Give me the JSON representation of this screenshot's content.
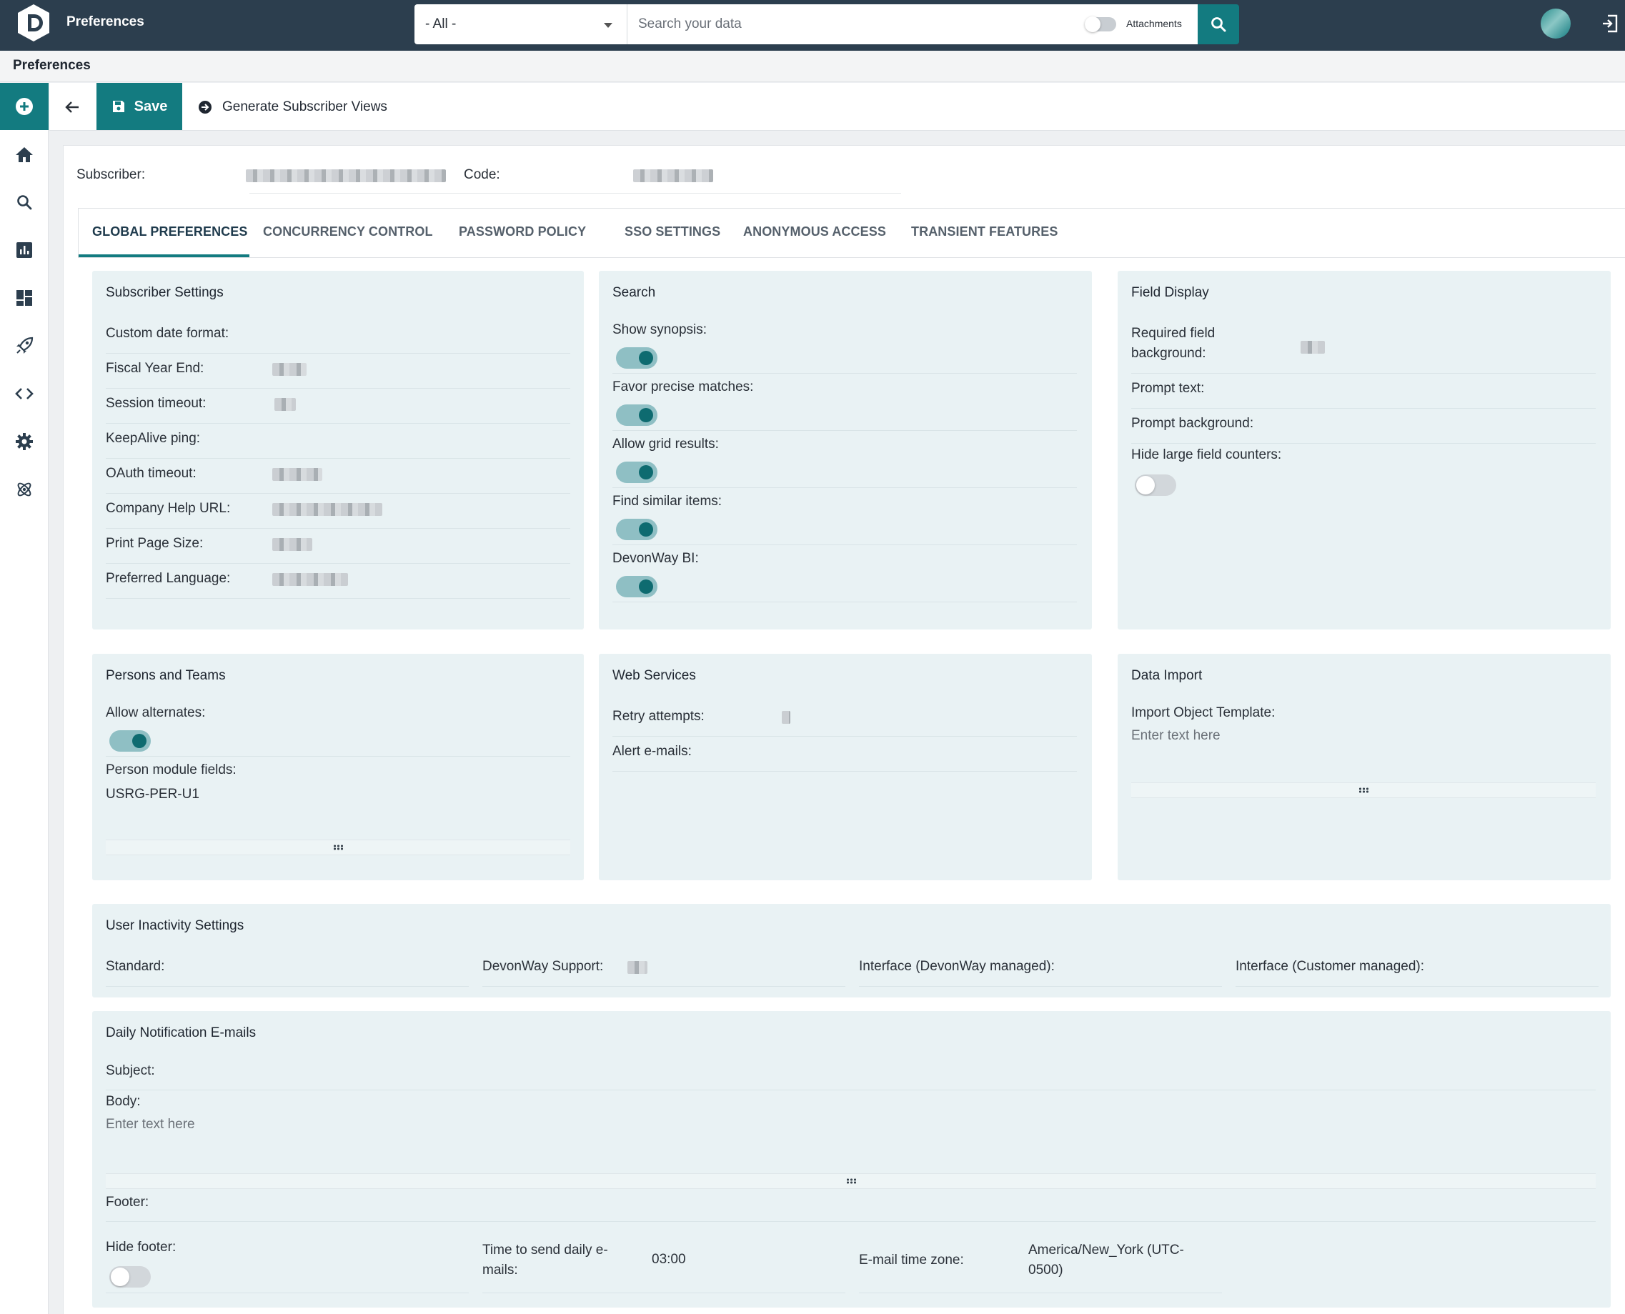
{
  "topbar": {
    "app_title": "Preferences",
    "scope_select": "- All -",
    "search_placeholder": "Search your data",
    "attachments_label": "Attachments"
  },
  "breadcrumb": "Preferences",
  "toolbar": {
    "save_label": "Save",
    "generate_label": "Generate Subscriber Views"
  },
  "header": {
    "subscriber_label": "Subscriber:",
    "code_label": "Code:"
  },
  "tabs": [
    "GLOBAL PREFERENCES",
    "CONCURRENCY CONTROL",
    "PASSWORD POLICY",
    "SSO SETTINGS",
    "ANONYMOUS ACCESS",
    "TRANSIENT FEATURES"
  ],
  "subscriber_settings": {
    "title": "Subscriber Settings",
    "rows": [
      "Custom date format:",
      "Fiscal Year End:",
      "Session timeout:",
      "KeepAlive ping:",
      "OAuth timeout:",
      "Company Help URL:",
      "Print Page Size:",
      "Preferred Language:"
    ]
  },
  "search_panel": {
    "title": "Search",
    "rows": [
      "Show synopsis:",
      "Favor precise matches:",
      "Allow grid results:",
      "Find similar items:",
      "DevonWay BI:"
    ]
  },
  "field_display": {
    "title": "Field Display",
    "required_bg": "Required field background:",
    "prompt_text": "Prompt text:",
    "prompt_bg": "Prompt background:",
    "hide_counters": "Hide large field counters:"
  },
  "persons_teams": {
    "title": "Persons and Teams",
    "allow_alternates": "Allow alternates:",
    "module_fields": "Person module fields:",
    "module_value": "USRG-PER-U1"
  },
  "web_services": {
    "title": "Web Services",
    "retry": "Retry attempts:",
    "alert": "Alert e-mails:"
  },
  "data_import": {
    "title": "Data Import",
    "template": "Import Object Template:",
    "placeholder": "Enter text here"
  },
  "inactivity": {
    "title": "User Inactivity Settings",
    "standard": "Standard:",
    "support": "DevonWay Support:",
    "iface_dw": "Interface (DevonWay managed):",
    "iface_cust": "Interface (Customer managed):"
  },
  "daily": {
    "title": "Daily Notification E-mails",
    "subject": "Subject:",
    "body": "Body:",
    "body_placeholder": "Enter text here",
    "footer": "Footer:",
    "hide_footer": "Hide footer:",
    "time_label": "Time to send daily e-mails:",
    "time_value": "03:00",
    "tz_label": "E-mail time zone:",
    "tz_value": "America/New_York (UTC-0500)"
  },
  "colors": {
    "topbar": "#2c3e4e",
    "accent": "#137b80",
    "panel": "#e9f2f4"
  },
  "icons": [
    "logo-icon",
    "search-icon",
    "logout-icon",
    "plus-icon",
    "home-icon",
    "chart-icon",
    "dashboard-icon",
    "rocket-icon",
    "code-icon",
    "gear-icon",
    "atom-icon",
    "back-arrow-icon",
    "save-icon",
    "arrow-circle-icon"
  ]
}
